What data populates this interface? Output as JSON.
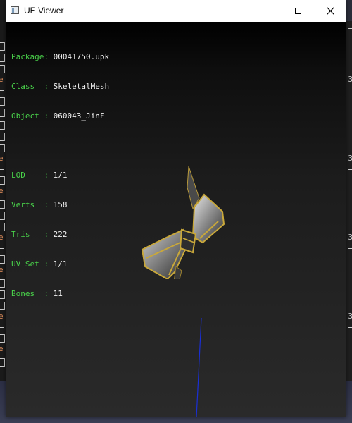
{
  "window": {
    "title": "UE Viewer"
  },
  "controls": {
    "minimize": "minimize",
    "maximize": "maximize",
    "close": "close"
  },
  "info_top": [
    {
      "key": "Package",
      "value": "00041750.upk"
    },
    {
      "key": "Class  ",
      "value": "SkeletalMesh"
    },
    {
      "key": "Object ",
      "value": "060043_JinF"
    }
  ],
  "info_bottom": [
    {
      "key": "LOD    ",
      "value": "1/1"
    },
    {
      "key": "Verts  ",
      "value": "158"
    },
    {
      "key": "Tris   ",
      "value": "222"
    },
    {
      "key": "UV Set ",
      "value": "1/1"
    },
    {
      "key": "Bones  ",
      "value": "11"
    }
  ],
  "colors": {
    "info_key": "#49d14a",
    "info_value": "#f0f0f0",
    "viewport_top": "#000000",
    "viewport_bottom": "#2a2a2a",
    "axis": "#1a2fd6",
    "mesh_gold": "#c9a83a"
  }
}
